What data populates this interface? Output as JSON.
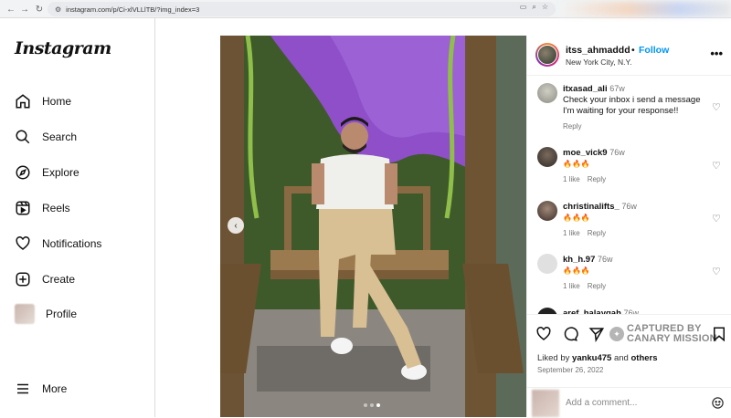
{
  "browser": {
    "url": "instagram.com/p/Ci-xlVLLlTB/?img_index=3",
    "back_icon": "←",
    "forward_icon": "→",
    "reload_icon": "↻"
  },
  "sidebar": {
    "logo": "Instagram",
    "items": [
      {
        "label": "Home",
        "icon": "home-icon"
      },
      {
        "label": "Search",
        "icon": "search-icon"
      },
      {
        "label": "Explore",
        "icon": "explore-icon"
      },
      {
        "label": "Reels",
        "icon": "reels-icon"
      },
      {
        "label": "Notifications",
        "icon": "heart-icon"
      },
      {
        "label": "Create",
        "icon": "plus-icon"
      },
      {
        "label": "Profile",
        "icon": "avatar"
      },
      {
        "label": "More",
        "icon": "menu-icon"
      }
    ]
  },
  "post": {
    "username": "itss_ahmaddd",
    "separator": "•",
    "follow_label": "Follow",
    "location": "New York City, N.Y.",
    "more_label": "•••",
    "prev_label": "‹",
    "carousel": {
      "count": 3,
      "active": 3
    }
  },
  "comments": [
    {
      "user": "itxasad_ali",
      "time": "67w",
      "text": "Check your inbox i send a message I'm waiting for your response!!",
      "likes": "",
      "reply": "Reply"
    },
    {
      "user": "moe_vick9",
      "time": "76w",
      "text": "🔥🔥🔥",
      "likes": "1 like",
      "reply": "Reply"
    },
    {
      "user": "christinalifts_",
      "time": "76w",
      "text": "🔥🔥🔥",
      "likes": "1 like",
      "reply": "Reply"
    },
    {
      "user": "kh_h.97",
      "time": "76w",
      "text": "🔥🔥🔥",
      "likes": "1 like",
      "reply": "Reply"
    },
    {
      "user": "aref_halaygah",
      "time": "76w",
      "text": "",
      "likes": "",
      "reply": ""
    }
  ],
  "actions": {
    "watermark_line1": "CAPTURED BY",
    "watermark_line2": "CANARY MISSION",
    "likes_prefix": "Liked by",
    "liked_user": "yanku475",
    "likes_and": "and",
    "likes_others": "others",
    "date": "September 26, 2022",
    "add_comment_placeholder": "Add a comment..."
  }
}
